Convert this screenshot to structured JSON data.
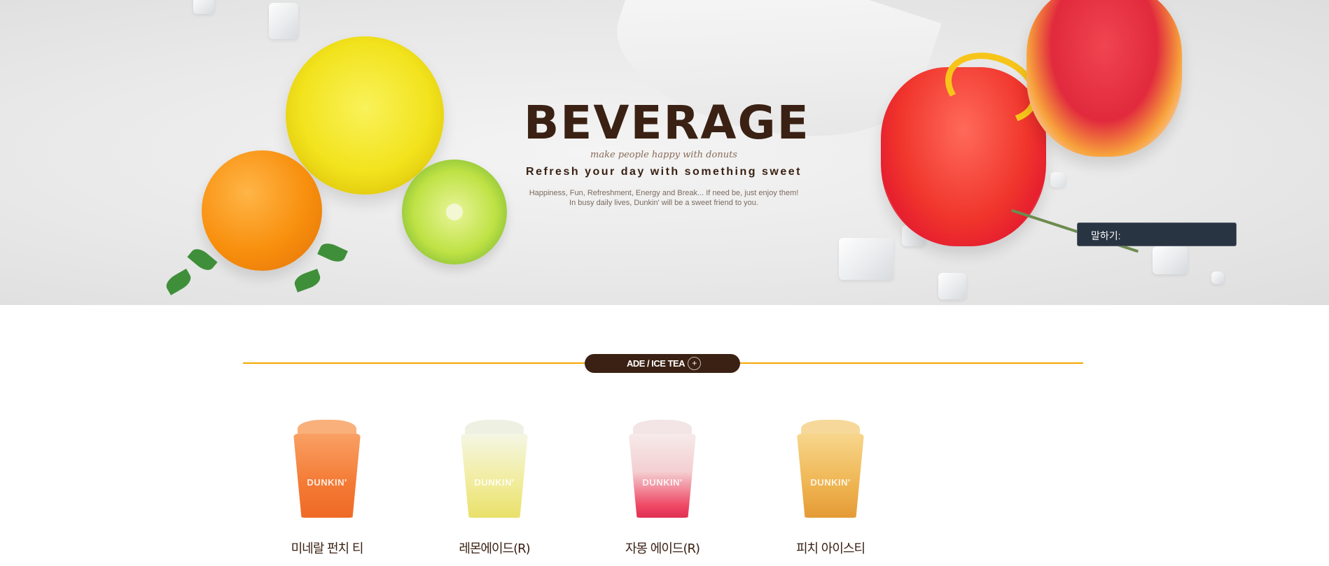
{
  "hero": {
    "title": "BEVERAGE",
    "script_line": "make people happy with donuts",
    "subtitle": "Refresh your day with something sweet",
    "desc_line1": "Happiness, Fun, Refreshment, Energy and Break... If need be, just enjoy them!",
    "desc_line2": "In busy daily lives, Dunkin' will be a sweet friend to you."
  },
  "speak_box": {
    "label": "말하기:"
  },
  "category": {
    "label": "ADE / ICE TEA",
    "plus_icon": "+",
    "accent_color": "#f5a800",
    "pill_color": "#3a2113"
  },
  "products": [
    {
      "name": "미네랄 펀치 티",
      "logo": "DUNKIN'",
      "color": "#f47a34"
    },
    {
      "name": "레몬에이드(R)",
      "logo": "DUNKIN'",
      "color": "#f1ec9a"
    },
    {
      "name": "자몽 에이드(R)",
      "logo": "DUNKIN'",
      "color": "#ef4a66"
    },
    {
      "name": "피치 아이스티",
      "logo": "DUNKIN'",
      "color": "#efb552"
    }
  ]
}
